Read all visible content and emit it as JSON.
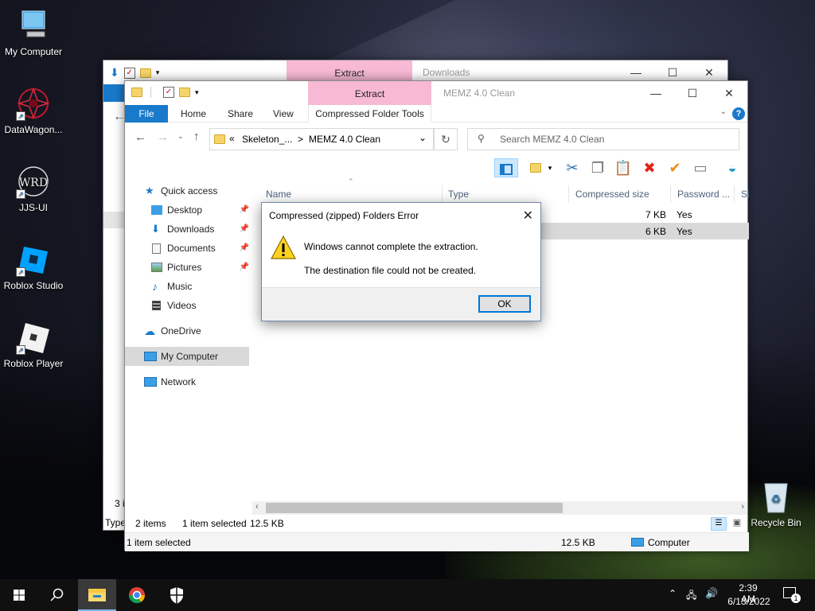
{
  "desktop": {
    "icons": [
      {
        "label": "My Computer"
      },
      {
        "label": "DataWagon..."
      },
      {
        "label": "JJS-UI"
      },
      {
        "label": "Roblox Studio"
      },
      {
        "label": "Roblox Player"
      },
      {
        "label": "Recycle Bin"
      }
    ],
    "jjs_logo_text": "WRD"
  },
  "back_window": {
    "title": "Downloads",
    "context_tab": "Extract",
    "status_count": "3 i",
    "status_type": "Type"
  },
  "front_window": {
    "title": "MEMZ 4.0 Clean",
    "context_tab": "Extract",
    "ribbon_tabs": [
      "File",
      "Home",
      "Share",
      "View",
      "Compressed Folder Tools"
    ],
    "address": {
      "prefix": "«",
      "crumb1": "Skeleton_...",
      "sep": ">",
      "crumb2": "MEMZ 4.0 Clean"
    },
    "search_placeholder": "Search MEMZ 4.0 Clean",
    "nav": [
      {
        "label": "Quick access",
        "pinned": false
      },
      {
        "label": "Desktop",
        "pinned": true
      },
      {
        "label": "Downloads",
        "pinned": true
      },
      {
        "label": "Documents",
        "pinned": true
      },
      {
        "label": "Pictures",
        "pinned": true
      },
      {
        "label": "Music",
        "pinned": false
      },
      {
        "label": "Videos",
        "pinned": false
      },
      {
        "label": "OneDrive",
        "pinned": false
      },
      {
        "label": "My Computer",
        "pinned": false
      },
      {
        "label": "Network",
        "pinned": false
      }
    ],
    "columns": [
      "Name",
      "Type",
      "Compressed size",
      "Password ...",
      "Si"
    ],
    "rows": [
      {
        "size": "7 KB",
        "password": "Yes"
      },
      {
        "size": "6 KB",
        "password": "Yes"
      }
    ],
    "status": {
      "items": "2 items",
      "selected": "1 item selected",
      "size": "12.5 KB"
    },
    "details_bar": {
      "selected": "1 item selected",
      "size": "12.5 KB",
      "location": "Computer"
    }
  },
  "dialog": {
    "title": "Compressed (zipped) Folders Error",
    "message1": "Windows cannot complete the extraction.",
    "message2": "The destination file could not be created.",
    "ok_label": "OK"
  },
  "taskbar": {
    "time": "2:39 AM",
    "date": "6/13/2022",
    "notif_count": "1"
  },
  "colors": {
    "accent": "#1979ca",
    "context_tab": "#f7b9d4",
    "selection": "#cce8ff"
  }
}
